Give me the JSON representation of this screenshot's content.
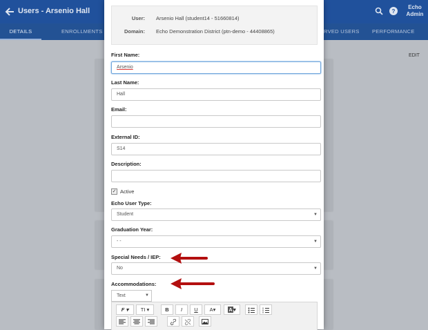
{
  "appbar": {
    "title": "Users - Arsenio Hall",
    "admin_line1": "Echo",
    "admin_line2": "Admin"
  },
  "tabs": [
    {
      "label": "DETAILS"
    },
    {
      "label": "ENROLLMENTS"
    },
    {
      "label": "RVED USERS"
    },
    {
      "label": "PERFORMANCE"
    }
  ],
  "edit_label": "EDIT",
  "dialog": {
    "summary": {
      "user_key": "User:",
      "user_value": "Arsenio Hall (student14 - 51660814)",
      "domain_key": "Domain:",
      "domain_value": "Echo Demonstration District (ptn-demo - 44408865)"
    },
    "fields": {
      "first_name": {
        "label": "First Name:",
        "value": "Arsenio"
      },
      "last_name": {
        "label": "Last Name:",
        "value": "Hall"
      },
      "email": {
        "label": "Email:",
        "value": ""
      },
      "external_id": {
        "label": "External ID:",
        "value": "S14"
      },
      "description": {
        "label": "Description:",
        "value": ""
      },
      "active": {
        "label": "Active",
        "checked": true
      },
      "user_type": {
        "label": "Echo User Type:",
        "value": "Student"
      },
      "graduation_year": {
        "label": "Graduation Year:",
        "value": "- -"
      },
      "special_needs": {
        "label": "Special Needs / IEP:",
        "value": "No"
      },
      "accommodations": {
        "label": "Accommodations:",
        "format": "Text"
      }
    },
    "toolbar": {
      "font": "F",
      "size": "TI",
      "bold": "B",
      "italic": "I",
      "underline": "U",
      "font_color": "A",
      "highlight": "A"
    }
  },
  "colors": {
    "appbar": "#20519c",
    "arrow": "#b30f0f",
    "focus": "#6ea5dc"
  }
}
